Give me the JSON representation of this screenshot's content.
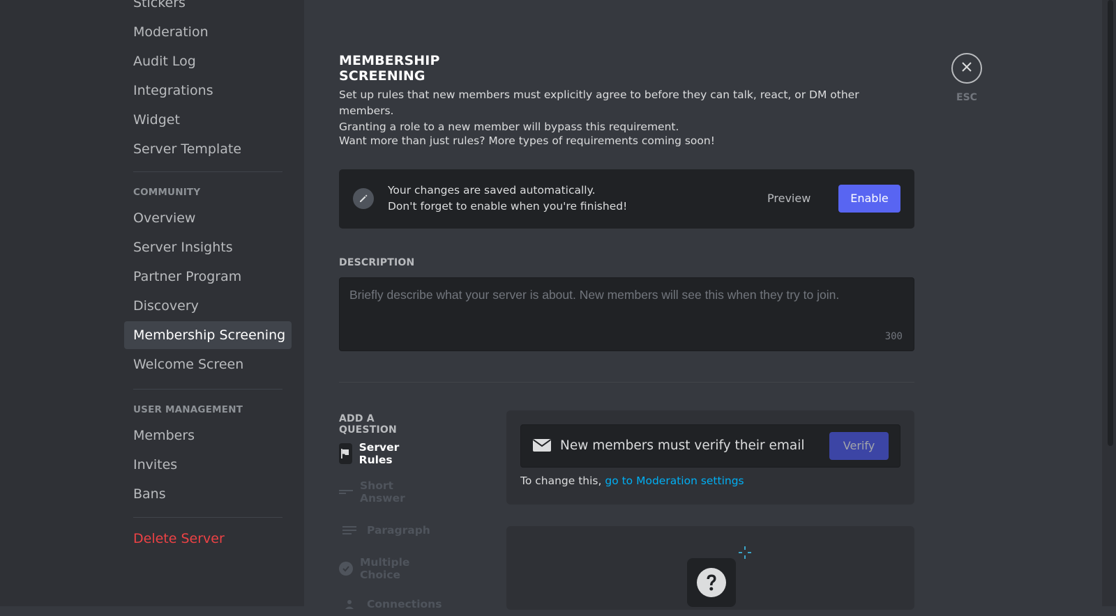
{
  "sidebar": {
    "items_top": [
      {
        "label": "Stickers"
      },
      {
        "label": "Moderation"
      },
      {
        "label": "Audit Log"
      },
      {
        "label": "Integrations"
      },
      {
        "label": "Widget"
      },
      {
        "label": "Server Template"
      }
    ],
    "community_header": "COMMUNITY",
    "community_items": [
      {
        "label": "Overview"
      },
      {
        "label": "Server Insights"
      },
      {
        "label": "Partner Program"
      },
      {
        "label": "Discovery"
      },
      {
        "label": "Membership Screening"
      },
      {
        "label": "Welcome Screen"
      }
    ],
    "user_mgmt_header": "USER MANAGEMENT",
    "user_mgmt_items": [
      {
        "label": "Members"
      },
      {
        "label": "Invites"
      },
      {
        "label": "Bans"
      }
    ],
    "delete_label": "Delete Server",
    "active_item": "Membership Screening"
  },
  "main": {
    "title": "MEMBERSHIP SCREENING",
    "intro_line1": "Set up rules that new members must explicitly agree to before they can talk, react, or DM other members.",
    "intro_line2": "Granting a role to a new member will bypass this requirement.",
    "intro_more": "Want more than just rules? More types of requirements coming soon!",
    "notice": {
      "line1": "Your changes are saved automatically.",
      "line2": "Don't forget to enable when you're finished!",
      "preview_label": "Preview",
      "enable_label": "Enable"
    },
    "description": {
      "label": "DESCRIPTION",
      "placeholder": "Briefly describe what your server is about. New members will see this when they try to join.",
      "value": "",
      "counter": "300"
    },
    "add_question": {
      "label": "ADD A QUESTION",
      "types": [
        {
          "label": "Server Rules",
          "enabled": true
        },
        {
          "label": "Short Answer",
          "enabled": false
        },
        {
          "label": "Paragraph",
          "enabled": false
        },
        {
          "label": "Multiple Choice",
          "enabled": false
        },
        {
          "label": "Connections",
          "enabled": false
        }
      ]
    },
    "verification": {
      "text": "New members must verify their email",
      "button_label": "Verify",
      "change_prefix": "To change this, ",
      "change_link": "go to Moderation settings"
    }
  },
  "close": {
    "esc_label": "ESC"
  },
  "colors": {
    "background": "#36393f",
    "sidebar": "#2f3136",
    "accent": "#5865f2",
    "danger": "#ed4245",
    "link": "#00aff4"
  }
}
